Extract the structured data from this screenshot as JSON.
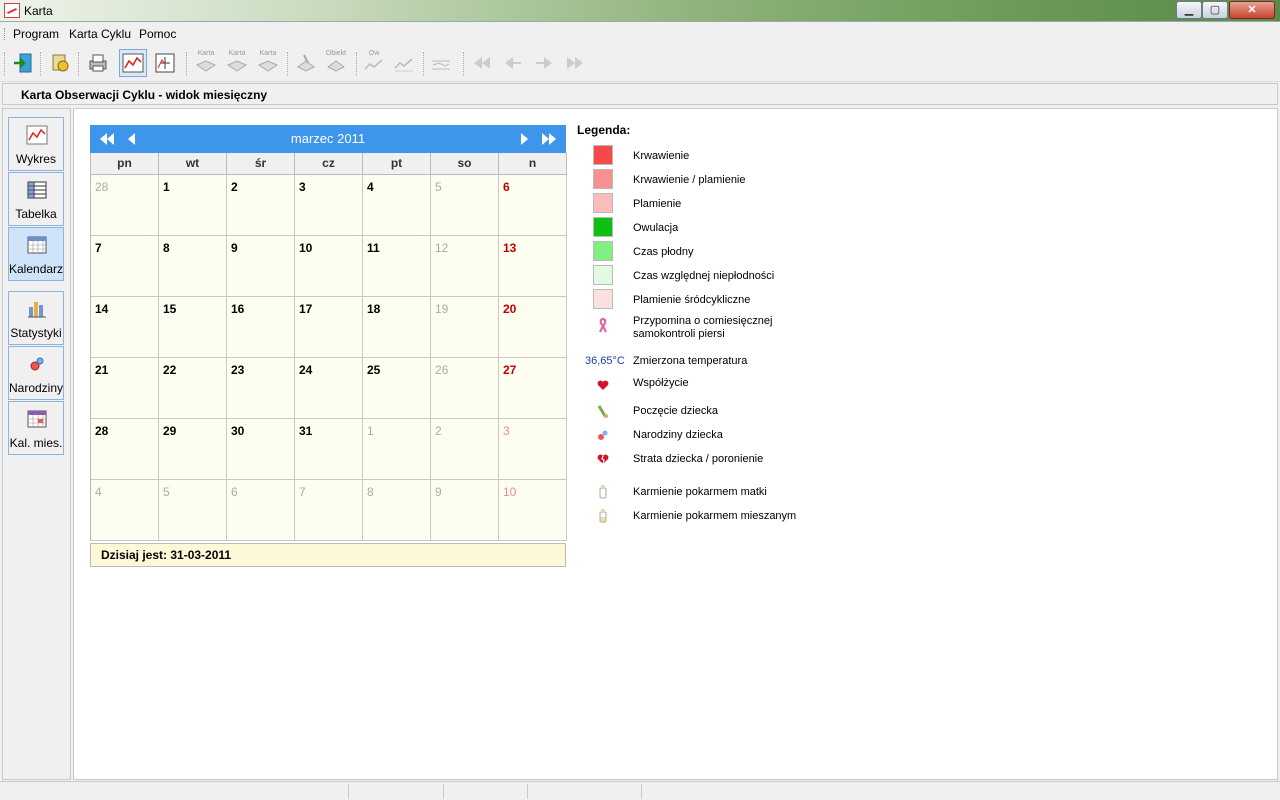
{
  "window": {
    "title": "Karta"
  },
  "menu": [
    "Program",
    "Karta Cyklu",
    "Pomoc"
  ],
  "toolbar": {
    "labels": [
      "Karta",
      "Karta",
      "Karta",
      "Obiekt",
      "Ow"
    ]
  },
  "header": {
    "title": "Karta Obserwacji Cyklu - widok miesięczny"
  },
  "sidebar": {
    "items": [
      {
        "label": "Wykres",
        "icon": "chart-icon"
      },
      {
        "label": "Tabelka",
        "icon": "table-icon"
      },
      {
        "label": "Kalendarz",
        "icon": "calendar-icon",
        "selected": true
      },
      {
        "label": "Statystyki",
        "icon": "stats-icon"
      },
      {
        "label": "Narodziny",
        "icon": "pacifier-icon"
      },
      {
        "label": "Kal. mies.",
        "icon": "month-calendar-icon"
      }
    ]
  },
  "calendar": {
    "month": "marzec 2011",
    "weekdays": [
      "pn",
      "wt",
      "śr",
      "cz",
      "pt",
      "so",
      "n"
    ],
    "weeks": [
      [
        "28",
        "1",
        "2",
        "3",
        "4",
        "5",
        "6"
      ],
      [
        "7",
        "8",
        "9",
        "10",
        "11",
        "12",
        "13"
      ],
      [
        "14",
        "15",
        "16",
        "17",
        "18",
        "19",
        "20"
      ],
      [
        "21",
        "22",
        "23",
        "24",
        "25",
        "26",
        "27"
      ],
      [
        "28",
        "29",
        "30",
        "31",
        "1",
        "2",
        "3"
      ],
      [
        "4",
        "5",
        "6",
        "7",
        "8",
        "9",
        "10"
      ]
    ],
    "today_label": "Dzisiaj jest: 31-03-2011"
  },
  "legend": {
    "title": "Legenda:",
    "swatches": [
      {
        "label": "Krwawienie",
        "color": "#f44a4a"
      },
      {
        "label": "Krwawienie / plamienie",
        "color": "#f79090"
      },
      {
        "label": "Plamienie",
        "color": "#fbbcbc"
      },
      {
        "label": "Owulacja",
        "color": "#10c010"
      },
      {
        "label": "Czas płodny",
        "color": "#80f080"
      },
      {
        "label": "Czas względnej niepłodności",
        "color": "#e2fae2"
      },
      {
        "label": "Plamienie śródcykliczne",
        "color": "#fbe0e0"
      }
    ],
    "reminder": {
      "line1": "Przypomina o comiesięcznej",
      "line2": "samokontroli piersi"
    },
    "temperature": {
      "value": "36,65°C",
      "label": "Zmierzona temperatura"
    },
    "icons": [
      {
        "label": "Współżycie"
      },
      {
        "label": "Poczęcie dziecka"
      },
      {
        "label": "Narodziny dziecka"
      },
      {
        "label": "Strata dziecka / poronienie"
      },
      {
        "label": "Karmienie pokarmem matki"
      },
      {
        "label": "Karmienie pokarmem mieszanym"
      }
    ]
  }
}
